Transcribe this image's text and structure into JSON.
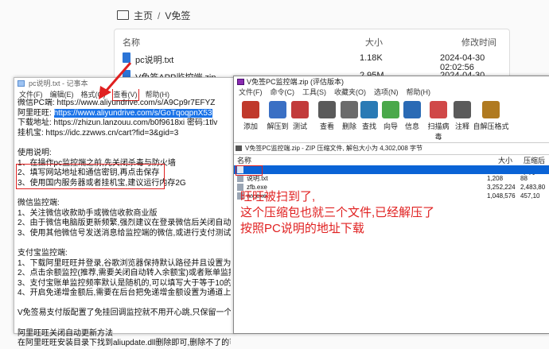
{
  "explorer": {
    "breadcrumb": [
      "主页",
      "V免签"
    ],
    "columns": {
      "name": "名称",
      "size": "大小",
      "modified": "修改时间"
    },
    "files": [
      {
        "name": "pc说明.txt",
        "size": "1.18K",
        "modified": "2024-04-30 02:02:56"
      },
      {
        "name": "V免签APP监控端.zip",
        "size": "2.95M",
        "modified": "2024-04-30 02:02:34"
      }
    ]
  },
  "notepad": {
    "title": "pc说明.txt - 记事本",
    "menu": [
      "文件(F)",
      "编辑(E)",
      "格式(O)",
      "查看(V)",
      "帮助(H)"
    ],
    "lines": [
      {
        "pre": "微信PC端: https://www.aliyundrive.com/s/A9Cp9r7EFYZ",
        "hl": ""
      },
      {
        "pre": "阿里旺旺: ",
        "hl": "https://www.aliyundrive.com/s/GoTqoqpnX53"
      },
      {
        "pre": "下载地址: https://zhizun.lanzouu.com/b0f9618xi 密码:1tlv",
        "hl": ""
      },
      {
        "pre": "挂机宝: https://idc.zzwws.cn/cart?fid=3&gid=3",
        "hl": ""
      },
      {
        "pre": "",
        "hl": ""
      },
      {
        "pre": "使用说明:",
        "hl": ""
      },
      {
        "pre": "1、在操作pc监控端之前,先关闭杀毒与防火墙",
        "hl": ""
      },
      {
        "pre": "2、填写网站地址和通信密钥,再点击保存",
        "hl": ""
      },
      {
        "pre": "3、使用国内服务器或者挂机宝,建议运行内存2G",
        "hl": ""
      },
      {
        "pre": "",
        "hl": ""
      },
      {
        "pre": "微信监控端:",
        "hl": ""
      },
      {
        "pre": "1、关注微信收款助手或微信收款商业版",
        "hl": ""
      },
      {
        "pre": "2、由于微信电脑版更新频繁,强烈建议在登录微信后关闭自动升级微信,",
        "hl": ""
      },
      {
        "pre": "3、使用其他微信号发送消息给监控端的微信,或进行支付测试,如果获取",
        "hl": ""
      },
      {
        "pre": "",
        "hl": ""
      },
      {
        "pre": "支付宝监控端:",
        "hl": ""
      },
      {
        "pre": "1、下载阿里旺旺并登录,谷歌浏览器保持默认路径并且设置为默认浏览器",
        "hl": ""
      },
      {
        "pre": "2、点击余额监控(推荐,需要关闭自动转入余额宝)或者账单监控",
        "hl": ""
      },
      {
        "pre": "3、支付宝账单监控频率默认是随机的,可以填写大于等于10的整数",
        "hl": ""
      },
      {
        "pre": "4、开启免递增金额后,需要在后台把免递增金额设置为通道上,设置后必须开启",
        "hl": ""
      },
      {
        "pre": "",
        "hl": ""
      },
      {
        "pre": "V免签易支付版配置了免挂回调监控就不用开心跳,只保留一个心跳即可,",
        "hl": ""
      },
      {
        "pre": "",
        "hl": ""
      },
      {
        "pre": "阿里旺旺关闭自动更新方法",
        "hl": ""
      },
      {
        "pre": "在阿里旺旺安装目录下找到aliupdate.dll删除即可,删除不了的可以打开",
        "hl": ""
      }
    ]
  },
  "zip": {
    "title": "V免签PC监控端.zip (评估版本)",
    "menu": [
      "文件(F)",
      "命令(C)",
      "工具(S)",
      "收藏夹(O)",
      "选项(N)",
      "帮助(H)"
    ],
    "tools": [
      {
        "label": "添加",
        "color": "#c0392b"
      },
      {
        "label": "解压到",
        "color": "#3a6fc4"
      },
      {
        "label": "测试",
        "color": "#c23b3b"
      },
      {
        "label": "查看",
        "color": "#5a5a5a"
      },
      {
        "label": "删除",
        "color": "#6b6b6b"
      },
      {
        "label": "查找",
        "color": "#2a7ab5"
      },
      {
        "label": "向导",
        "color": "#4aa84a"
      },
      {
        "label": "信息",
        "color": "#2a6ab5"
      },
      {
        "label": "扫描病毒",
        "color": "#d04848"
      },
      {
        "label": "注释",
        "color": "#5a5a5a"
      },
      {
        "label": "自解压格式",
        "color": "#b07a20"
      }
    ],
    "path": "V免签PC监控端.zip - ZIP 压缩文件, 解包大小为 4,302,008 字节",
    "columns": {
      "name": "名称",
      "size": "大小",
      "packed": "压缩后大小"
    },
    "rows": [
      {
        "name": "",
        "size": "",
        "packed": "",
        "selected": true
      },
      {
        "name": "说明.txt",
        "size": "1,208",
        "packed": "88",
        "selected": false
      },
      {
        "name": "zfb.exe",
        "size": "3,252,224",
        "packed": "2,483,80",
        "selected": false
      },
      {
        "name": "wx.exe",
        "size": "1,048,576",
        "packed": "457,10",
        "selected": false
      }
    ],
    "annotation": "旺旺被扫到了,\n这个压缩包也就三个文件,已经解压了\n按照PC说明的地址下载"
  },
  "colors": {
    "annotation_red": "#e02020",
    "selection_blue": "#1a73e8"
  }
}
